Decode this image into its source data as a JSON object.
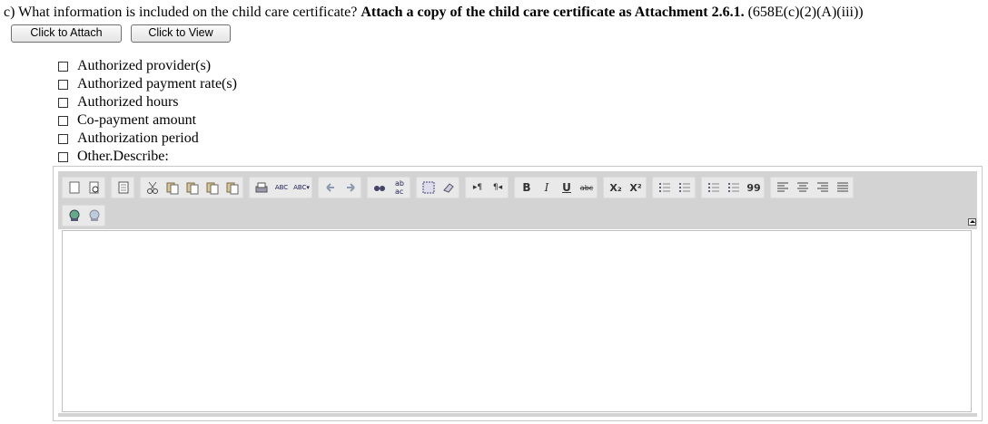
{
  "question": {
    "prefix": "c) What information is included on the child care certificate? ",
    "bold": "Attach a copy of the child care certificate as Attachment 2.6.1.",
    "suffix": " (658E(c)(2)(A)(iii))"
  },
  "buttons": {
    "attach": "Click to Attach",
    "view": "Click to View"
  },
  "options": [
    "Authorized provider(s)",
    "Authorized payment rate(s)",
    "Authorized hours",
    "Co-payment amount",
    "Authorization period",
    "Other.Describe:"
  ],
  "toolbar": {
    "row1": [
      [
        "new-page-icon",
        "preview-icon"
      ],
      [
        "templates-icon"
      ],
      [
        "cut-icon",
        "copy-icon",
        "paste-icon",
        "paste-text-icon",
        "paste-word-icon"
      ],
      [
        "print-icon",
        "spellcheck-icon",
        "spellcheck-dropdown-icon"
      ],
      [
        "undo-icon",
        "redo-icon"
      ],
      [
        "find-icon",
        "replace-icon"
      ],
      [
        "select-all-icon",
        "remove-format-icon"
      ],
      [
        "ltr-icon",
        "rtl-icon"
      ],
      [
        "bold-icon",
        "italic-icon",
        "underline-icon",
        "strike-icon"
      ],
      [
        "subscript-icon",
        "superscript-icon"
      ],
      [
        "numbered-list-icon",
        "bulleted-list-icon"
      ],
      [
        "outdent-icon",
        "indent-icon",
        "blockquote-icon"
      ],
      [
        "align-left-icon",
        "align-center-icon",
        "align-right-icon",
        "justify-icon"
      ]
    ],
    "row2": [
      "link-icon",
      "unlink-icon"
    ],
    "glyphs": {
      "bold": "B",
      "italic": "I",
      "underline": "U",
      "strike": "abc",
      "sub": "X₂",
      "sup": "X²",
      "quote": "99",
      "spell": "ABC"
    }
  }
}
